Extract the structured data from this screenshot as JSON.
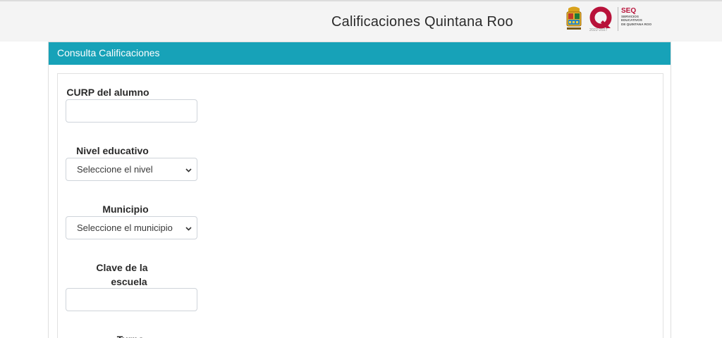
{
  "header": {
    "title": "Calificaciones Quintana Roo",
    "logo_q_year": "2022-2027",
    "seq": {
      "title": "SEQ",
      "subtitle_lines": [
        "SERVICIOS",
        "EDUCATIVOS",
        "DE QUINTANA ROO"
      ]
    }
  },
  "panel": {
    "heading": "Consulta Calificaciones",
    "accent_color": "#17a2b8"
  },
  "form": {
    "curp_label": "CURP del alumno",
    "curp_value": "",
    "nivel_label": "Nivel educativo",
    "nivel_selected": "Seleccione el nivel",
    "municipio_label": "Municipio",
    "municipio_selected": "Seleccione el municipio",
    "clave_label_line1": "Clave de la",
    "clave_label_line2": "escuela",
    "clave_value": "",
    "turno_label": "Turno"
  },
  "icons": [
    "chevron-down-icon",
    "state-emblem-icon",
    "q-logo-icon"
  ],
  "colors": {
    "brand_red": "#b8123a",
    "header_bg": "#f4f4f4"
  }
}
